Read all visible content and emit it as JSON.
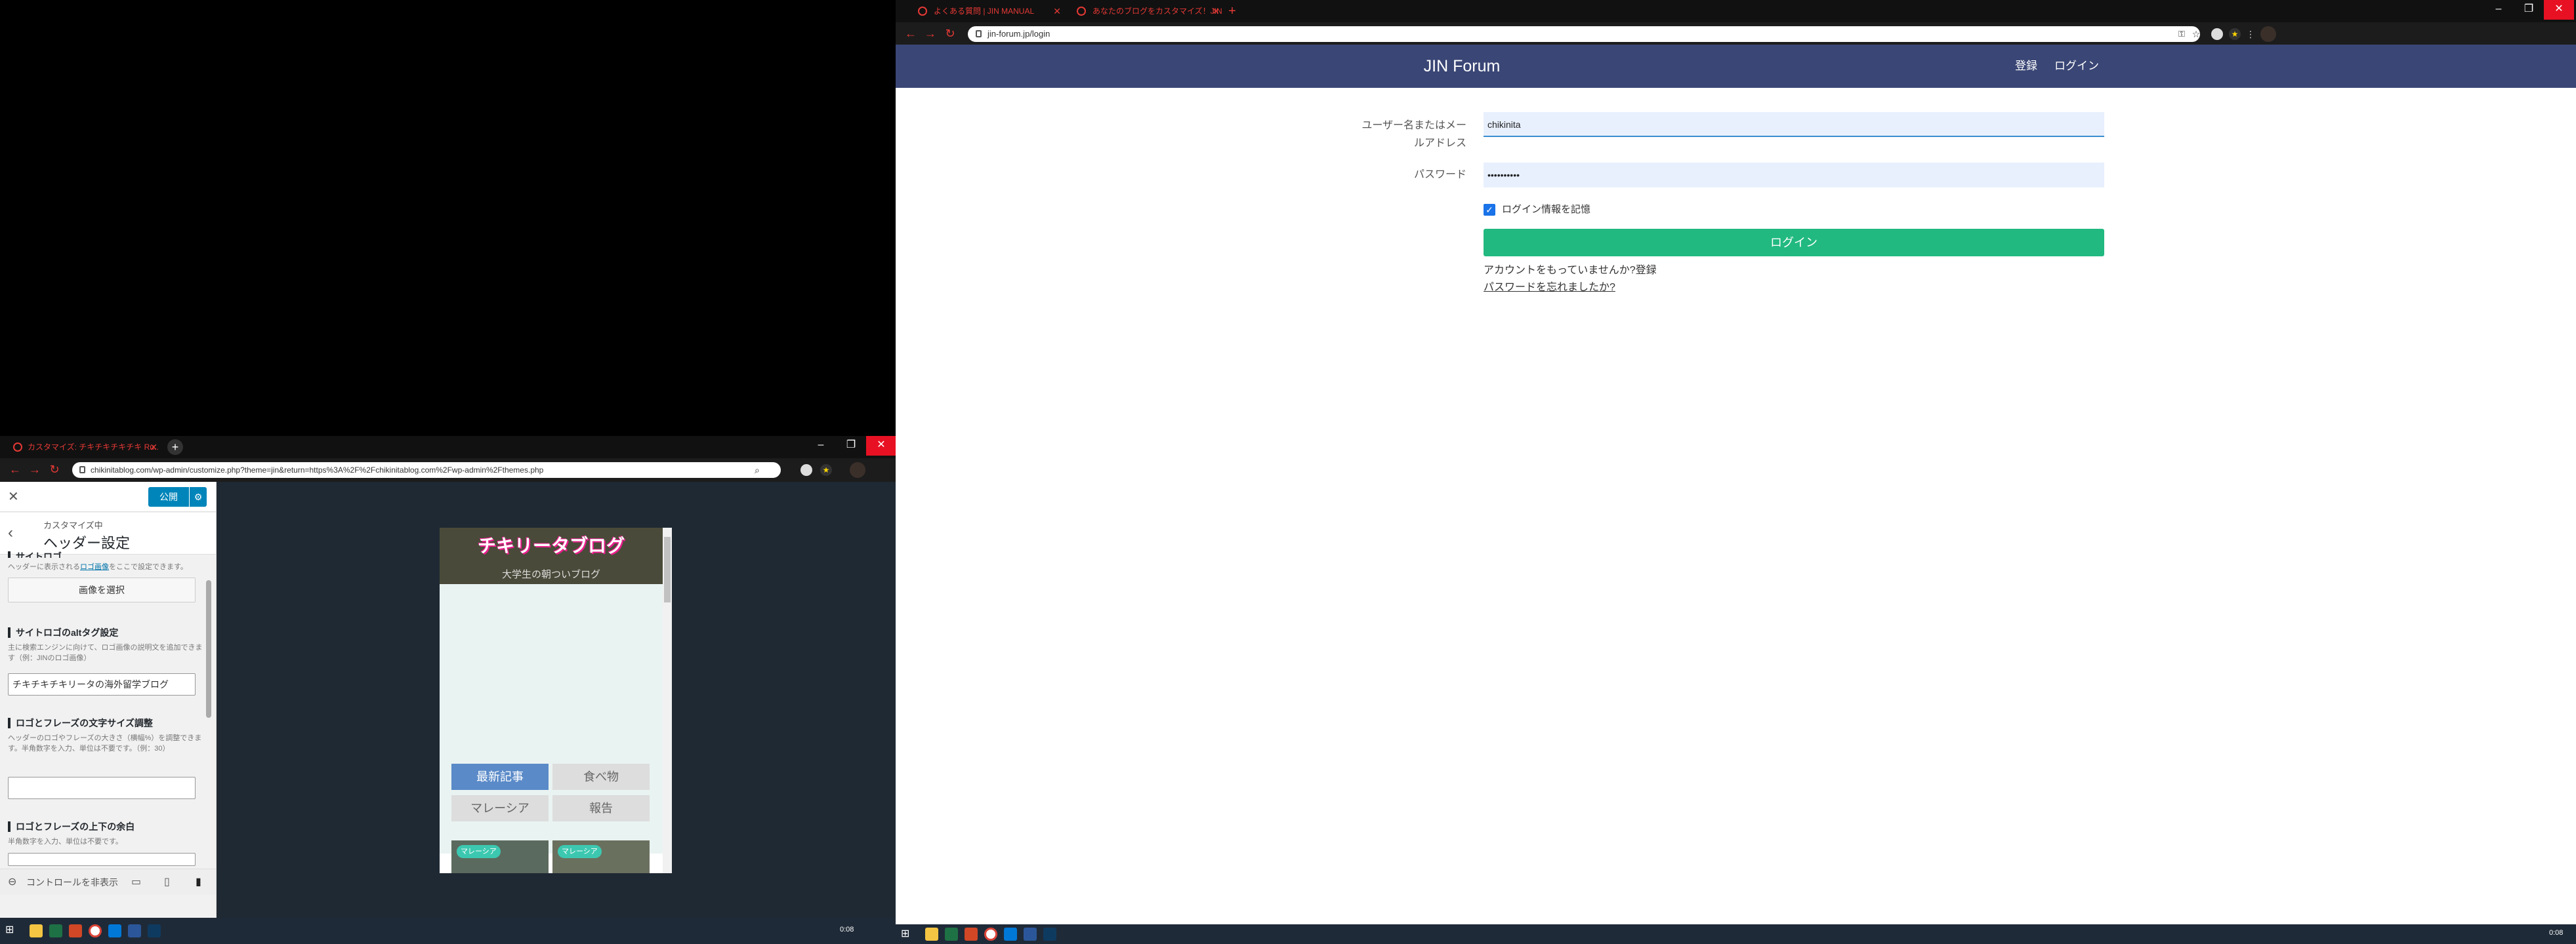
{
  "right_browser": {
    "tabs": [
      {
        "title": "よくある質問 | JIN MANUAL"
      },
      {
        "title": "あなたのブログをカスタマイズ！JIN Fo..."
      }
    ],
    "url": "jin-forum.jp/login",
    "site_title": "JIN Forum",
    "nav": {
      "register": "登録",
      "login": "ログイン"
    },
    "form": {
      "username_label_line1": "ユーザー名またはメー",
      "username_label_line2": "ルアドレス",
      "username_value": "chikinita",
      "password_label": "パスワード",
      "password_value": "••••••••••",
      "remember_label": "ログイン情報を記憶",
      "login_button": "ログイン",
      "no_account_text": "アカウントをもっていませんか?",
      "register_link": "登録",
      "forgot_password": "パスワードを忘れましたか?"
    },
    "colors": {
      "header": "#3a4675",
      "login_button": "#21b980"
    }
  },
  "left_browser": {
    "tab_title": "カスタマイズ: チキチキチキチキ Ru..",
    "url": "chikinitablog.com/wp-admin/customize.php?theme=jin&return=https%3A%2F%2Fchikinitablog.com%2Fwp-admin%2Fthemes.php",
    "customizer": {
      "publish_button": "公開",
      "breadcrumb": "カスタマイズ中",
      "panel_title": "ヘッダー設定",
      "partial_heading": "サイトロゴ",
      "logo_desc_prefix": "ヘッダーに表示される",
      "logo_desc_link": "ロゴ画像",
      "logo_desc_suffix": "をここで設定できます。",
      "select_image_button": "画像を選択",
      "alt_title": "サイトロゴのaltタグ設定",
      "alt_desc": "主に検索エンジンに向けて、ロゴ画像の説明文を追加できます（例：JINのロゴ画像）",
      "alt_value": "チキチキチキリータの海外留学ブログ",
      "size_title": "ロゴとフレーズの文字サイズ調整",
      "size_desc": "ヘッダーのロゴやフレーズの大きさ（横幅%）を調整できます。半角数字を入力、単位は不要です。（例：30）",
      "size_value": "",
      "margin_title": "ロゴとフレーズの上下の余白",
      "margin_desc": "半角数字を入力、単位は不要です。",
      "hide_controls": "コントロールを非表示"
    },
    "preview": {
      "blog_title": "チキリータブログ",
      "tagline": "大学生の朝ついブログ",
      "menu": [
        "最新記事",
        "食べ物",
        "マレーシア",
        "報告"
      ],
      "card_tags": [
        "マレーシア",
        "マレーシア"
      ]
    }
  },
  "taskbar": {
    "time": "0:08"
  }
}
